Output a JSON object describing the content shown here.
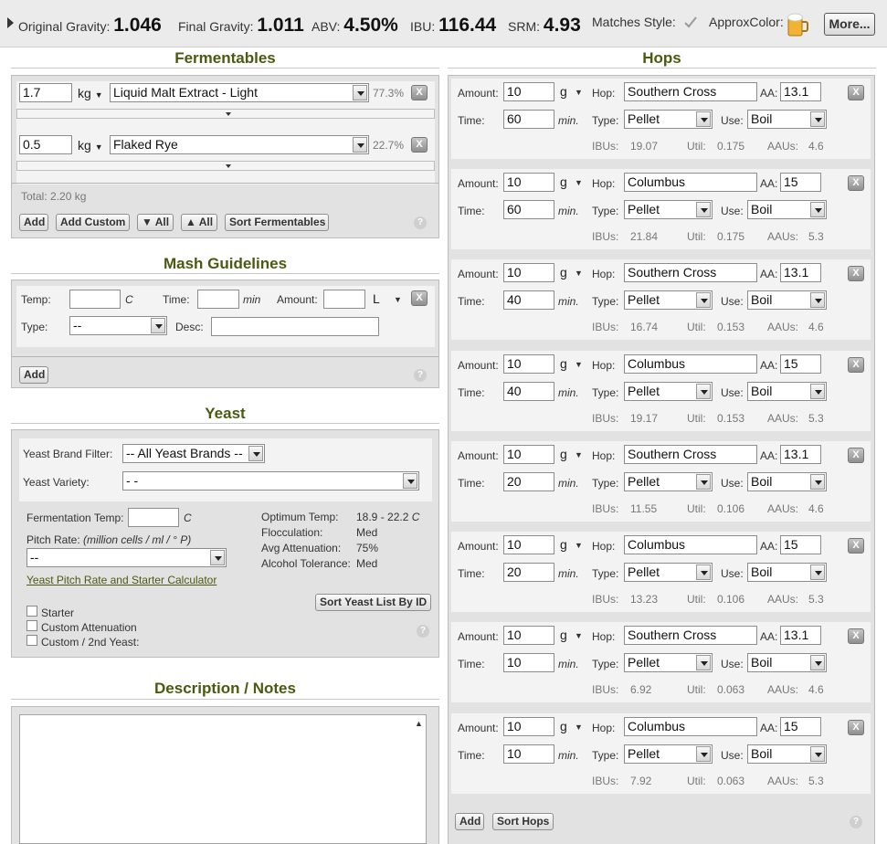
{
  "stats": {
    "og_label": "Original Gravity:",
    "og": "1.046",
    "fg_label": "Final Gravity:",
    "fg": "1.011",
    "abv_label": "ABV:",
    "abv": "4.50%",
    "ibu_label": "IBU:",
    "ibu": "116.44",
    "srm_label": "SRM:",
    "srm": "4.93",
    "matches_label": "Matches Style:",
    "color_label": "ApproxColor:",
    "more": "More..."
  },
  "fermentables": {
    "title": "Fermentables",
    "items": [
      {
        "amount": "1.7",
        "unit": "kg",
        "name": "Liquid Malt Extract - Light",
        "pct": "77.3%"
      },
      {
        "amount": "0.5",
        "unit": "kg",
        "name": "Flaked Rye",
        "pct": "22.7%"
      }
    ],
    "total": "Total: 2.20 kg",
    "buttons": {
      "add": "Add",
      "add_custom": "Add Custom",
      "all_down": "▼ All",
      "all_up": "▲ All",
      "sort": "Sort Fermentables"
    }
  },
  "mash": {
    "title": "Mash Guidelines",
    "temp_label": "Temp:",
    "temp_unit": "C",
    "time_label": "Time:",
    "time_unit": "min",
    "amount_label": "Amount:",
    "amount_unit": "L",
    "type_label": "Type:",
    "type_value": "--",
    "desc_label": "Desc:",
    "add": "Add"
  },
  "yeast": {
    "title": "Yeast",
    "brand_label": "Yeast Brand Filter:",
    "brand_value": "-- All Yeast Brands --",
    "variety_label": "Yeast Variety:",
    "variety_value": "- -",
    "ferm_temp_label": "Fermentation Temp:",
    "ferm_temp_unit": "C",
    "pitch_label": "Pitch Rate:",
    "pitch_hint": "(million cells / ml / ° P)",
    "pitch_value": "--",
    "calc_link": "Yeast Pitch Rate and Starter Calculator",
    "optimum_label": "Optimum Temp:",
    "optimum_value": "18.9 - 22.2",
    "optimum_unit": "C",
    "floc_label": "Flocculation:",
    "floc_value": "Med",
    "atten_label": "Avg Attenuation:",
    "atten_value": "75%",
    "tol_label": "Alcohol Tolerance:",
    "tol_value": "Med",
    "sort_btn": "Sort Yeast List By ID",
    "starter": "Starter",
    "custom_atten": "Custom Attenuation",
    "custom_yeast": "Custom / 2nd Yeast:"
  },
  "notes": {
    "title": "Description / Notes"
  },
  "hops": {
    "title": "Hops",
    "labels": {
      "amount": "Amount:",
      "unit": "g",
      "hop": "Hop:",
      "aa": "AA:",
      "time": "Time:",
      "min": "min.",
      "type": "Type:",
      "use": "Use:",
      "ibus": "IBUs:",
      "util": "Util:",
      "aaus": "AAUs:"
    },
    "items": [
      {
        "amount": "10",
        "hop": "Southern Cross",
        "aa": "13.1",
        "time": "60",
        "type": "Pellet",
        "use": "Boil",
        "ibus": "19.07",
        "util": "0.175",
        "aaus": "4.6"
      },
      {
        "amount": "10",
        "hop": "Columbus",
        "aa": "15",
        "time": "60",
        "type": "Pellet",
        "use": "Boil",
        "ibus": "21.84",
        "util": "0.175",
        "aaus": "5.3"
      },
      {
        "amount": "10",
        "hop": "Southern Cross",
        "aa": "13.1",
        "time": "40",
        "type": "Pellet",
        "use": "Boil",
        "ibus": "16.74",
        "util": "0.153",
        "aaus": "4.6"
      },
      {
        "amount": "10",
        "hop": "Columbus",
        "aa": "15",
        "time": "40",
        "type": "Pellet",
        "use": "Boil",
        "ibus": "19.17",
        "util": "0.153",
        "aaus": "5.3"
      },
      {
        "amount": "10",
        "hop": "Southern Cross",
        "aa": "13.1",
        "time": "20",
        "type": "Pellet",
        "use": "Boil",
        "ibus": "11.55",
        "util": "0.106",
        "aaus": "4.6"
      },
      {
        "amount": "10",
        "hop": "Columbus",
        "aa": "15",
        "time": "20",
        "type": "Pellet",
        "use": "Boil",
        "ibus": "13.23",
        "util": "0.106",
        "aaus": "5.3"
      },
      {
        "amount": "10",
        "hop": "Southern Cross",
        "aa": "13.1",
        "time": "10",
        "type": "Pellet",
        "use": "Boil",
        "ibus": "6.92",
        "util": "0.063",
        "aaus": "4.6"
      },
      {
        "amount": "10",
        "hop": "Columbus",
        "aa": "15",
        "time": "10",
        "type": "Pellet",
        "use": "Boil",
        "ibus": "7.92",
        "util": "0.063",
        "aaus": "5.3"
      }
    ],
    "add": "Add",
    "sort": "Sort Hops"
  },
  "colors": {
    "heading": "#4a5a10",
    "panel": "#e2e2e2",
    "beer": "#f2b234"
  }
}
